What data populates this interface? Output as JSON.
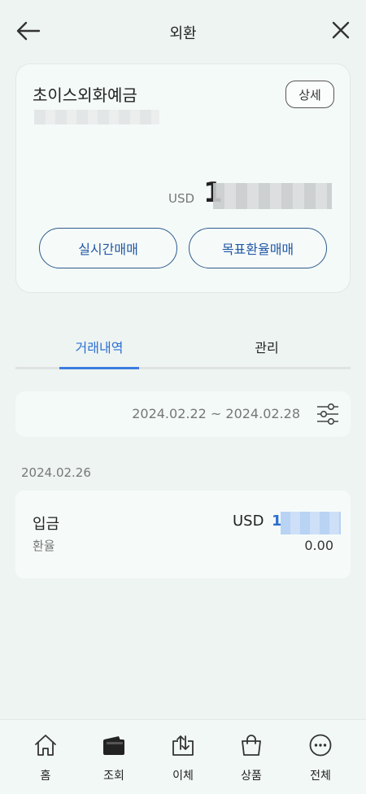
{
  "header": {
    "title": "외환",
    "back_icon": "arrow-left-icon",
    "close_icon": "close-icon"
  },
  "account": {
    "name": "초이스외화예금",
    "detail_label": "상세",
    "currency": "USD",
    "balance_visible": "1",
    "actions": {
      "realtime": "실시간매매",
      "target": "목표환율매매"
    }
  },
  "tabs": [
    {
      "label": "거래내역",
      "active": true
    },
    {
      "label": "관리",
      "active": false
    }
  ],
  "filter": {
    "date_range": "2024.02.22 ~ 2024.02.28",
    "icon": "filter-sliders-icon"
  },
  "transactions": {
    "date": "2024.02.26",
    "items": [
      {
        "type": "입금",
        "sub": "환율",
        "currency": "USD",
        "amount_visible": "1,",
        "rate": "0.00"
      }
    ]
  },
  "bottom_nav": [
    {
      "label": "홈",
      "icon": "home-icon"
    },
    {
      "label": "조회",
      "icon": "wallet-icon"
    },
    {
      "label": "이체",
      "icon": "transfer-icon"
    },
    {
      "label": "상품",
      "icon": "shopping-bag-icon"
    },
    {
      "label": "전체",
      "icon": "more-icon"
    }
  ],
  "colors": {
    "accent": "#2c6fd1",
    "background": "#eef4f2",
    "card": "#f4faf8"
  }
}
